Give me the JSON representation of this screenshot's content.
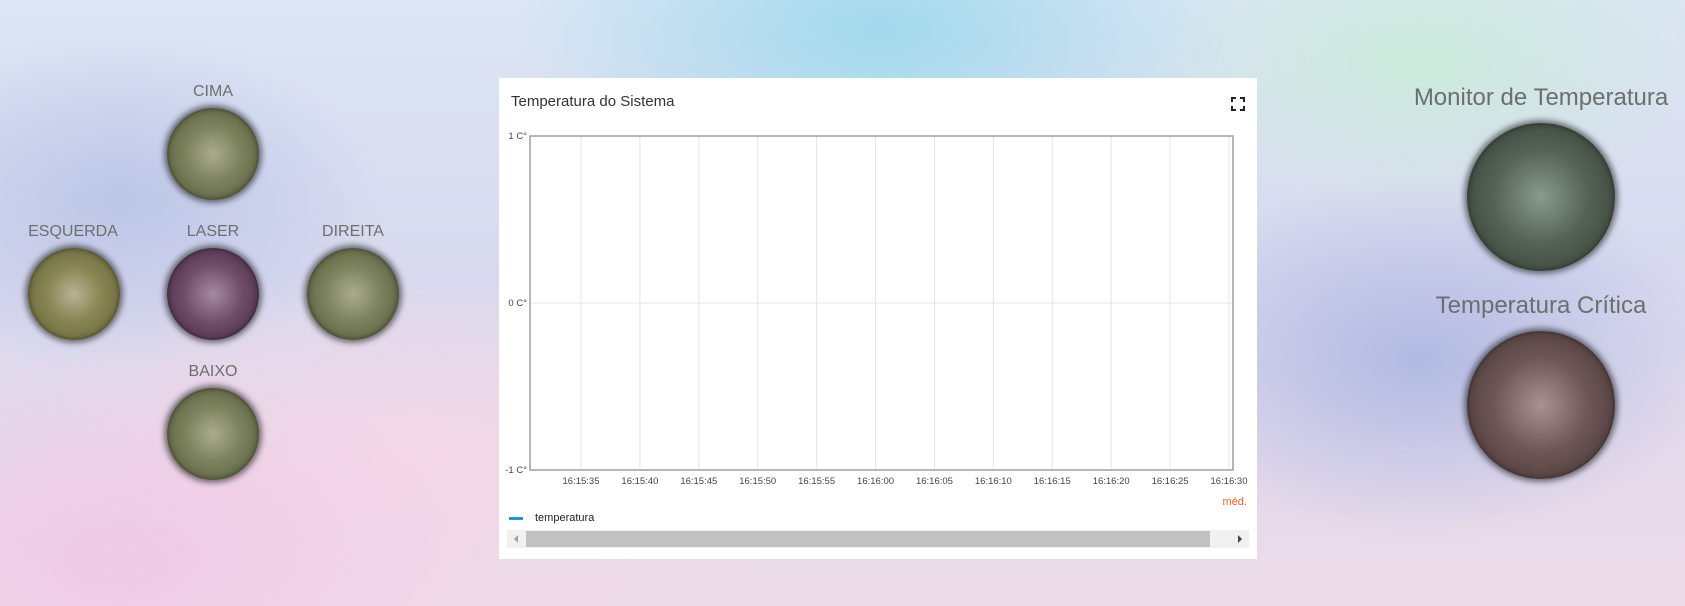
{
  "controls": {
    "up_label": "CIMA",
    "left_label": "ESQUERDA",
    "laser_label": "LASER",
    "right_label": "DIREITA",
    "down_label": "BAIXO"
  },
  "indicators": {
    "monitor_label": "Monitor de Temperatura",
    "critical_label": "Temperatura Crítica"
  },
  "colors": {
    "series_line": "#1f9ad6",
    "aggregation_text": "#ff5a1f"
  },
  "chart": {
    "title": "Temperatura do Sistema",
    "aggregation": "méd.",
    "fullscreen_icon": "fullscreen-icon"
  },
  "chart_data": {
    "type": "line",
    "title": "Temperatura do Sistema",
    "xlabel": "",
    "ylabel": "",
    "ylim": [
      -1,
      1
    ],
    "y_ticks": [
      "1 C°",
      "0 C°",
      "-1 C°"
    ],
    "x_ticks": [
      "16:15:35",
      "16:15:40",
      "16:15:45",
      "16:15:50",
      "16:15:55",
      "16:16:00",
      "16:16:05",
      "16:16:10",
      "16:16:15",
      "16:16:20",
      "16:16:25",
      "16:16:30"
    ],
    "grid": true,
    "legend_position": "bottom-left",
    "series": [
      {
        "name": "temperatura",
        "values": []
      }
    ]
  }
}
